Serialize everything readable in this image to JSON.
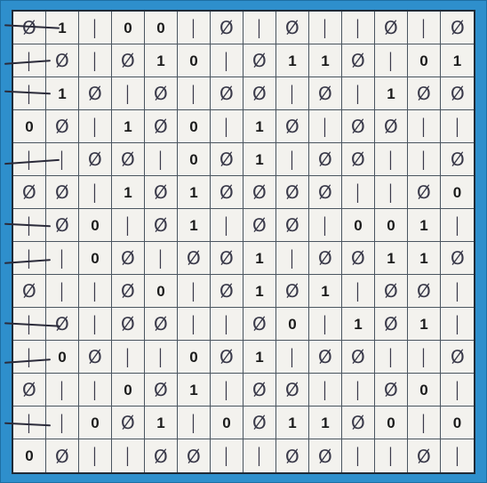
{
  "puzzle": {
    "size": 14,
    "colors": {
      "frame": "#2e8fcc",
      "paper": "#f3f2ee",
      "ink_given": "#1b1b1b",
      "ink_pen": "#3a3a4a"
    },
    "rows": [
      [
        [
          "0",
          "p"
        ],
        [
          "1",
          "g"
        ],
        [
          "1",
          "p"
        ],
        [
          "0",
          "g"
        ],
        [
          "0",
          "g"
        ],
        [
          "1",
          "p"
        ],
        [
          "0",
          "p"
        ],
        [
          "1",
          "p"
        ],
        [
          "0",
          "p"
        ],
        [
          "1",
          "p"
        ],
        [
          "1",
          "p"
        ],
        [
          "0",
          "p"
        ],
        [
          "1",
          "p"
        ],
        [
          "0",
          "p"
        ]
      ],
      [
        [
          "1",
          "p"
        ],
        [
          "0",
          "p"
        ],
        [
          "1",
          "p"
        ],
        [
          "0",
          "p"
        ],
        [
          "1",
          "g"
        ],
        [
          "0",
          "g"
        ],
        [
          "1",
          "p"
        ],
        [
          "0",
          "p"
        ],
        [
          "1",
          "g"
        ],
        [
          "1",
          "g"
        ],
        [
          "0",
          "p"
        ],
        [
          "1",
          "p"
        ],
        [
          "0",
          "g"
        ],
        [
          "1",
          "g"
        ]
      ],
      [
        [
          "1",
          "p"
        ],
        [
          "1",
          "g"
        ],
        [
          "0",
          "p"
        ],
        [
          "1",
          "p"
        ],
        [
          "0",
          "p"
        ],
        [
          "1",
          "p"
        ],
        [
          "0",
          "p"
        ],
        [
          "0",
          "p"
        ],
        [
          "1",
          "p"
        ],
        [
          "0",
          "p"
        ],
        [
          "1",
          "p"
        ],
        [
          "1",
          "g"
        ],
        [
          "0",
          "p"
        ],
        [
          "0",
          "p"
        ]
      ],
      [
        [
          "0",
          "g"
        ],
        [
          "0",
          "p"
        ],
        [
          "1",
          "p"
        ],
        [
          "1",
          "g"
        ],
        [
          "0",
          "p"
        ],
        [
          "0",
          "g"
        ],
        [
          "1",
          "p"
        ],
        [
          "1",
          "g"
        ],
        [
          "0",
          "p"
        ],
        [
          "1",
          "p"
        ],
        [
          "0",
          "p"
        ],
        [
          "0",
          "p"
        ],
        [
          "1",
          "p"
        ],
        [
          "1",
          "p"
        ]
      ],
      [
        [
          "1",
          "p"
        ],
        [
          "1",
          "p"
        ],
        [
          "0",
          "p"
        ],
        [
          "0",
          "p"
        ],
        [
          "1",
          "p"
        ],
        [
          "0",
          "g"
        ],
        [
          "0",
          "p"
        ],
        [
          "1",
          "g"
        ],
        [
          "1",
          "p"
        ],
        [
          "0",
          "p"
        ],
        [
          "0",
          "p"
        ],
        [
          "1",
          "p"
        ],
        [
          "1",
          "p"
        ],
        [
          "0",
          "p"
        ]
      ],
      [
        [
          "0",
          "p"
        ],
        [
          "0",
          "p"
        ],
        [
          "1",
          "p"
        ],
        [
          "1",
          "g"
        ],
        [
          "0",
          "p"
        ],
        [
          "1",
          "g"
        ],
        [
          "0",
          "p"
        ],
        [
          "0",
          "p"
        ],
        [
          "0",
          "p"
        ],
        [
          "0",
          "p"
        ],
        [
          "1",
          "p"
        ],
        [
          "1",
          "p"
        ],
        [
          "0",
          "p"
        ],
        [
          "0",
          "g"
        ]
      ],
      [
        [
          "1",
          "p"
        ],
        [
          "0",
          "p"
        ],
        [
          "0",
          "g"
        ],
        [
          "1",
          "p"
        ],
        [
          "0",
          "p"
        ],
        [
          "1",
          "g"
        ],
        [
          "1",
          "p"
        ],
        [
          "0",
          "p"
        ],
        [
          "0",
          "p"
        ],
        [
          "1",
          "p"
        ],
        [
          "0",
          "g"
        ],
        [
          "0",
          "g"
        ],
        [
          "1",
          "g"
        ],
        [
          "1",
          "p"
        ]
      ],
      [
        [
          "1",
          "p"
        ],
        [
          "1",
          "p"
        ],
        [
          "0",
          "g"
        ],
        [
          "0",
          "p"
        ],
        [
          "1",
          "p"
        ],
        [
          "0",
          "p"
        ],
        [
          "0",
          "p"
        ],
        [
          "1",
          "g"
        ],
        [
          "1",
          "p"
        ],
        [
          "0",
          "p"
        ],
        [
          "0",
          "p"
        ],
        [
          "1",
          "g"
        ],
        [
          "1",
          "g"
        ],
        [
          "0",
          "p"
        ]
      ],
      [
        [
          "0",
          "p"
        ],
        [
          "1",
          "p"
        ],
        [
          "1",
          "p"
        ],
        [
          "0",
          "p"
        ],
        [
          "0",
          "g"
        ],
        [
          "1",
          "p"
        ],
        [
          "0",
          "p"
        ],
        [
          "1",
          "g"
        ],
        [
          "0",
          "p"
        ],
        [
          "1",
          "g"
        ],
        [
          "1",
          "p"
        ],
        [
          "0",
          "p"
        ],
        [
          "0",
          "p"
        ],
        [
          "1",
          "p"
        ]
      ],
      [
        [
          "1",
          "p"
        ],
        [
          "0",
          "p"
        ],
        [
          "1",
          "p"
        ],
        [
          "0",
          "p"
        ],
        [
          "0",
          "p"
        ],
        [
          "1",
          "p"
        ],
        [
          "1",
          "p"
        ],
        [
          "0",
          "p"
        ],
        [
          "0",
          "g"
        ],
        [
          "1",
          "p"
        ],
        [
          "1",
          "g"
        ],
        [
          "0",
          "p"
        ],
        [
          "1",
          "g"
        ],
        [
          "1",
          "p"
        ]
      ],
      [
        [
          "1",
          "p"
        ],
        [
          "0",
          "g"
        ],
        [
          "0",
          "p"
        ],
        [
          "1",
          "p"
        ],
        [
          "1",
          "p"
        ],
        [
          "0",
          "g"
        ],
        [
          "0",
          "p"
        ],
        [
          "1",
          "g"
        ],
        [
          "1",
          "p"
        ],
        [
          "0",
          "p"
        ],
        [
          "0",
          "p"
        ],
        [
          "1",
          "p"
        ],
        [
          "1",
          "p"
        ],
        [
          "0",
          "p"
        ]
      ],
      [
        [
          "0",
          "p"
        ],
        [
          "1",
          "p"
        ],
        [
          "1",
          "p"
        ],
        [
          "0",
          "g"
        ],
        [
          "0",
          "p"
        ],
        [
          "1",
          "g"
        ],
        [
          "1",
          "p"
        ],
        [
          "0",
          "p"
        ],
        [
          "0",
          "p"
        ],
        [
          "1",
          "p"
        ],
        [
          "1",
          "p"
        ],
        [
          "0",
          "p"
        ],
        [
          "0",
          "g"
        ],
        [
          "1",
          "p"
        ]
      ],
      [
        [
          "1",
          "p"
        ],
        [
          "1",
          "p"
        ],
        [
          "0",
          "g"
        ],
        [
          "0",
          "p"
        ],
        [
          "1",
          "g"
        ],
        [
          "1",
          "p"
        ],
        [
          "0",
          "g"
        ],
        [
          "0",
          "p"
        ],
        [
          "1",
          "g"
        ],
        [
          "1",
          "g"
        ],
        [
          "0",
          "p"
        ],
        [
          "0",
          "g"
        ],
        [
          "1",
          "p"
        ],
        [
          "0",
          "g"
        ]
      ],
      [
        [
          "0",
          "g"
        ],
        [
          "0",
          "p"
        ],
        [
          "1",
          "p"
        ],
        [
          "1",
          "p"
        ],
        [
          "0",
          "p"
        ],
        [
          "0",
          "p"
        ],
        [
          "1",
          "p"
        ],
        [
          "1",
          "p"
        ],
        [
          "0",
          "p"
        ],
        [
          "0",
          "p"
        ],
        [
          "1",
          "p"
        ],
        [
          "1",
          "p"
        ],
        [
          "0",
          "p"
        ],
        [
          "1",
          "p"
        ]
      ]
    ]
  }
}
